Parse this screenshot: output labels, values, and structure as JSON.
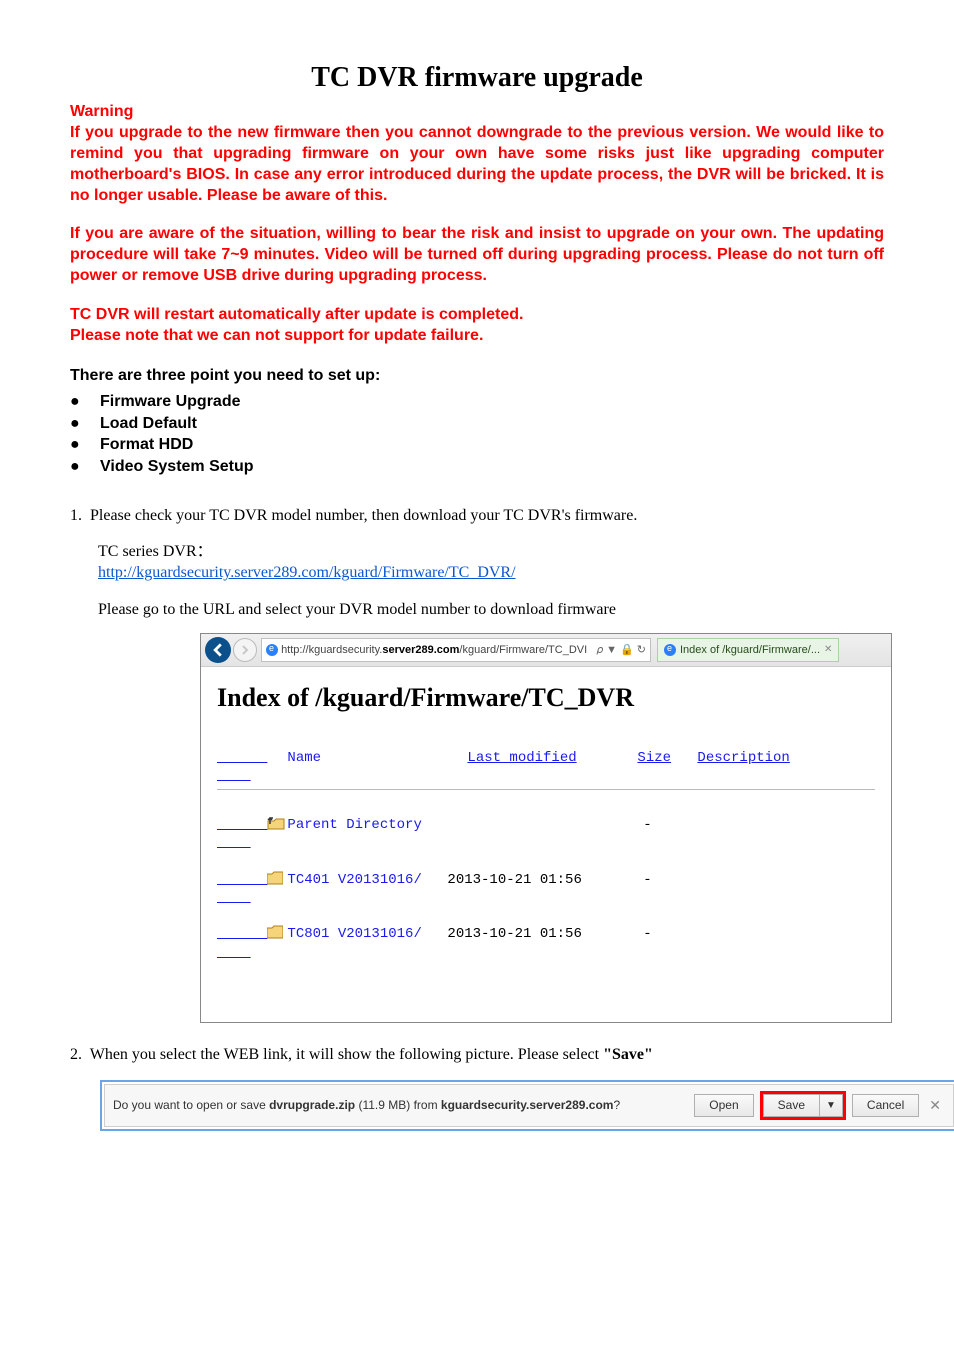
{
  "title": "TC DVR firmware upgrade",
  "warning": {
    "heading": "Warning",
    "p1": "If you upgrade to the new firmware then you cannot downgrade to the previous version. We would like to remind you that upgrading firmware on your own have some risks just like upgrading computer motherboard's BIOS. In case any error introduced during the update process, the DVR will be bricked. It is no longer usable. Please be aware of this.",
    "p2": "If you are aware of the situation, willing to bear the risk and insist to upgrade on your own. The updating procedure will take 7~9 minutes. Video will be turned off during upgrading process. Please do not turn off power or remove USB drive during upgrading process.",
    "p3a": "TC DVR will restart automatically after update is completed.",
    "p3b": "Please note that we can not support for update failure."
  },
  "setup": {
    "heading": "There are three point you need to set up:",
    "items": [
      "Firmware Upgrade",
      "Load Default",
      "Format HDD",
      "Video System Setup"
    ]
  },
  "step1": {
    "num": "1.",
    "text": "Please check your TC DVR model number, then download your TC DVR's firmware.",
    "series_label": "TC series DVR：",
    "url": "http://kguardsecurity.server289.com/kguard/Firmware/TC_DVR/",
    "goto": "Please go to the URL and select your DVR model number to download firmware"
  },
  "browser": {
    "addr_prefix": "http://kguardsecurity.",
    "addr_domain": "server289.com",
    "addr_suffix": "/kguard/Firmware/TC_DVI",
    "addr_icons": "𝜌 ▼  🔒 ↻",
    "tab_title": "Index of /kguard/Firmware/...",
    "tab_close": "✕",
    "listing_title": "Index of /kguard/Firmware/TC_DVR",
    "head_name": "Name",
    "head_mod": "Last modified",
    "head_size": "Size",
    "head_desc": "Description",
    "rows": [
      {
        "name": "Parent Directory",
        "mod": "",
        "size": "-",
        "type": "parent"
      },
      {
        "name": "TC401 V20131016/",
        "mod": "2013-10-21 01:56",
        "size": "-",
        "type": "folder"
      },
      {
        "name": "TC801 V20131016/",
        "mod": "2013-10-21 01:56",
        "size": "-",
        "type": "folder"
      }
    ]
  },
  "step2": {
    "num": "2.",
    "text_a": "When you select the WEB link, it will show the following picture. Please select ",
    "text_b": "\"Save\""
  },
  "download_bar": {
    "text_a": "Do you want to open or save ",
    "filename": "dvrupgrade.zip",
    "size": " (11.9 MB) from ",
    "domain": "kguardsecurity.server289.com",
    "q": "?",
    "open": "Open",
    "save": "Save",
    "caret": "▼",
    "cancel": "Cancel",
    "close": "✕"
  }
}
